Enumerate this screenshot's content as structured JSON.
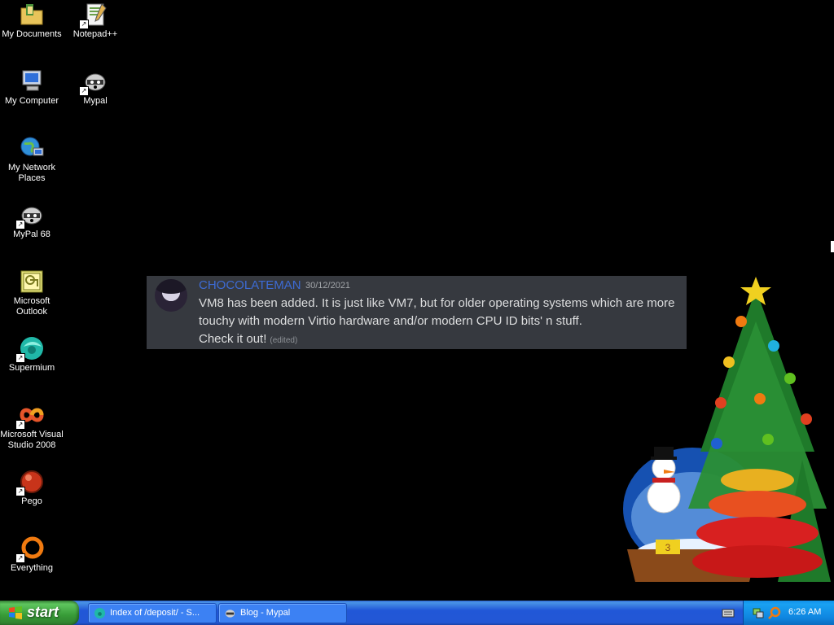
{
  "desktop": {
    "icons": [
      {
        "id": "my-documents",
        "label": "My Documents",
        "icon": "folder-icon"
      },
      {
        "id": "notepadpp",
        "label": "Notepad++",
        "icon": "notepad-icon"
      },
      {
        "id": "my-computer",
        "label": "My Computer",
        "icon": "computer-icon"
      },
      {
        "id": "mypal",
        "label": "Mypal",
        "icon": "raccoon-icon"
      },
      {
        "id": "network",
        "label": "My Network Places",
        "icon": "network-globe-icon"
      },
      {
        "id": "mypal68",
        "label": "MyPal 68",
        "icon": "raccoon-icon"
      },
      {
        "id": "outlook",
        "label": "Microsoft Outlook",
        "icon": "outlook-icon"
      },
      {
        "id": "supermium",
        "label": "Supermium",
        "icon": "supermium-icon"
      },
      {
        "id": "vs2008",
        "label": "Microsoft Visual Studio 2008",
        "icon": "visual-studio-icon"
      },
      {
        "id": "pego",
        "label": "Pego",
        "icon": "pego-icon"
      },
      {
        "id": "everything",
        "label": "Everything",
        "icon": "everything-icon"
      }
    ]
  },
  "chat": {
    "author": "CHOCOLATEMAN",
    "timestamp": "30/12/2021",
    "line1": "VM8 has been added. It is just like VM7, but for older operating systems which are more",
    "line2": "touchy with modern Virtio hardware and/or modern CPU ID bits' n stuff.",
    "line3": "Check it out!",
    "edited": "(edited)",
    "colors": {
      "background": "#36393f",
      "author": "#3d6bd4"
    }
  },
  "xmas": {
    "globe_number": "3"
  },
  "taskbar": {
    "start_label": "start",
    "tasks": [
      {
        "label": "Index of /deposit/ - S...",
        "icon": "supermium-icon"
      },
      {
        "label": "Blog - Mypal",
        "icon": "raccoon-icon"
      }
    ],
    "clock": "6:26 AM"
  }
}
